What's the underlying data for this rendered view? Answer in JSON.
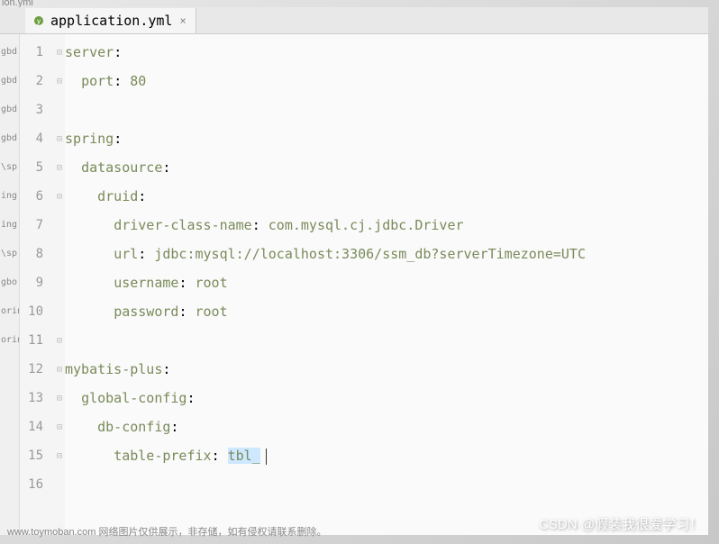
{
  "titleRemnant": "ion.yml",
  "tab": {
    "filename": "application.yml",
    "close": "×"
  },
  "sidebarLabels": [
    "gbd",
    "gbd",
    "gbd",
    "gbd",
    "\\sp",
    "ing",
    "ing",
    "\\sp",
    "gbo",
    "orin",
    "orin",
    "",
    "",
    "",
    "",
    ""
  ],
  "code": {
    "l1": {
      "indent": "",
      "key": "server",
      "colon": ":"
    },
    "l2": {
      "indent": "  ",
      "key": "port",
      "colon": ": ",
      "val": "80"
    },
    "l3": {
      "text": ""
    },
    "l4": {
      "indent": "",
      "key": "spring",
      "colon": ":"
    },
    "l5": {
      "indent": "  ",
      "key": "datasource",
      "colon": ":"
    },
    "l6": {
      "indent": "    ",
      "key": "druid",
      "colon": ":"
    },
    "l7": {
      "indent": "      ",
      "key": "driver-class-name",
      "colon": ": ",
      "val": "com.mysql.cj.jdbc.Driver"
    },
    "l8": {
      "indent": "      ",
      "key": "url",
      "colon": ": ",
      "val": "jdbc:mysql://localhost:3306/ssm_db?serverTimezone=UTC"
    },
    "l9": {
      "indent": "      ",
      "key": "username",
      "colon": ": ",
      "val": "root"
    },
    "l10": {
      "indent": "      ",
      "key": "password",
      "colon": ": ",
      "val": "root"
    },
    "l11": {
      "text": ""
    },
    "l12": {
      "indent": "",
      "key": "mybatis-plus",
      "colon": ":"
    },
    "l13": {
      "indent": "  ",
      "key": "global-config",
      "colon": ":"
    },
    "l14": {
      "indent": "    ",
      "key": "db-config",
      "colon": ":"
    },
    "l15": {
      "indent": "      ",
      "key": "table-prefix",
      "colon": ": ",
      "val": "tbl_"
    },
    "l16": {
      "text": ""
    }
  },
  "lineNumbers": [
    "1",
    "2",
    "3",
    "4",
    "5",
    "6",
    "7",
    "8",
    "9",
    "10",
    "11",
    "12",
    "13",
    "14",
    "15",
    "16"
  ],
  "foldMarks": [
    "⊟",
    "⊟",
    "",
    "⊟",
    "⊟",
    "⊟",
    "",
    "",
    "",
    "",
    "⊟",
    "⊟",
    "⊟",
    "⊟",
    "⊟",
    ""
  ],
  "watermarkLeft": "www.toymoban.com 网络图片仅供展示，非存储，如有侵权请联系删除。",
  "watermarkRight": "CSDN @假装我很爱学习！"
}
